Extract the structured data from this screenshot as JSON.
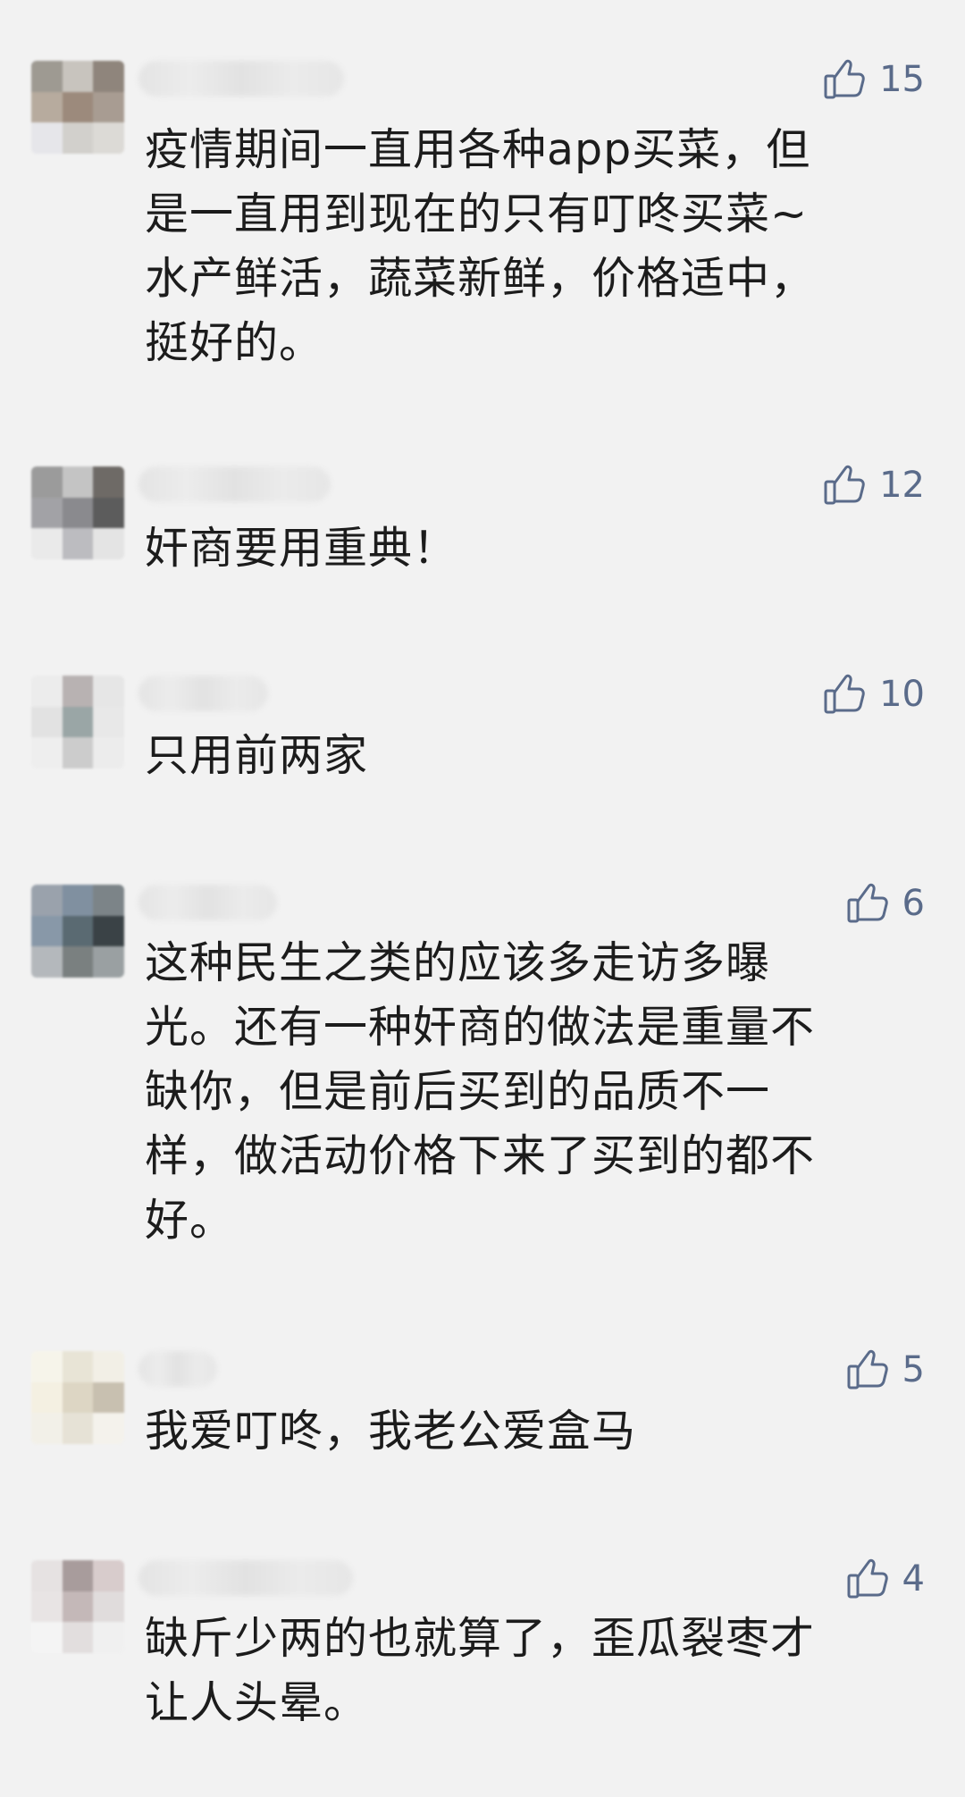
{
  "comments": [
    {
      "likes": "15",
      "text": "疫情期间一直用各种app买菜，但\n是一直用到现在的只有叮咚买菜~\n水产鲜活，蔬菜新鲜，价格适中，\n挺好的。",
      "avatar_colors": [
        "#9e9a92",
        "#c8c4be",
        "#8f857c",
        "#b7ab9e",
        "#9c8a7c",
        "#a89c92",
        "#e6e6ea",
        "#d2d0cc",
        "#dcdad6"
      ]
    },
    {
      "likes": "12",
      "text": "奸商要用重典！",
      "avatar_colors": [
        "#9b9b9b",
        "#c4c4c4",
        "#6e6a66",
        "#a2a2a6",
        "#8a8a8e",
        "#5c5c5c",
        "#eaeaea",
        "#bcbcc0",
        "#e4e4e4"
      ]
    },
    {
      "likes": "10",
      "text": "只用前两家",
      "avatar_colors": [
        "#ececec",
        "#b8b2b2",
        "#e6e6e6",
        "#e2e2e2",
        "#9aa6a6",
        "#e8e8e8",
        "#eeeeee",
        "#cccccc",
        "#ececec"
      ]
    },
    {
      "likes": "6",
      "text": "这种民生之类的应该多走访多曝\n光。还有一种奸商的做法是重量不\n缺你，但是前后买到的品质不一\n样，做活动价格下来了买到的都不\n好。",
      "avatar_colors": [
        "#9aa2ac",
        "#8090a0",
        "#7c8488",
        "#8898a8",
        "#5a6a72",
        "#3a4246",
        "#b4b8bc",
        "#7a8080",
        "#9aa0a2"
      ]
    },
    {
      "likes": "5",
      "text": "我爱叮咚，我老公爱盒马",
      "avatar_colors": [
        "#f6f4ea",
        "#e8e4d6",
        "#f2efe6",
        "#f4f0e2",
        "#ddd6c4",
        "#c8c0b0",
        "#f2f0e8",
        "#e6e2d6",
        "#f4f2ec"
      ]
    },
    {
      "likes": "4",
      "text": "缺斤少两的也就算了，歪瓜裂枣才\n让人头晕。",
      "avatar_colors": [
        "#e6e2e2",
        "#a89c9c",
        "#d8cccc",
        "#e8e4e4",
        "#c4b8b8",
        "#e0dcdc",
        "#f4f4f4",
        "#e2dede",
        "#f0f0f0"
      ]
    }
  ]
}
